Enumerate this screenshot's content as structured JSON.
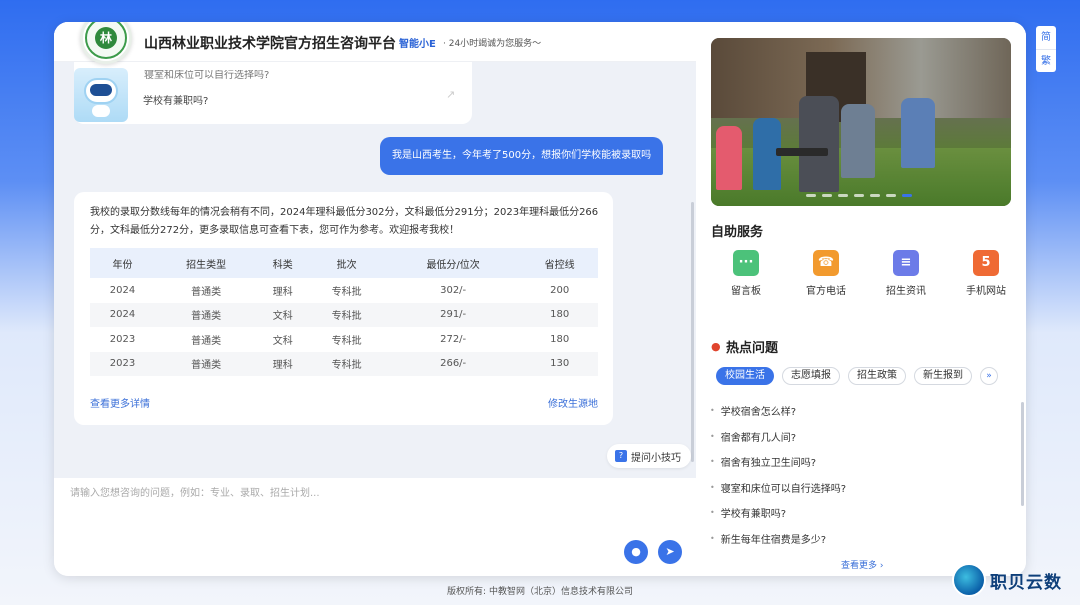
{
  "header": {
    "title": "山西林业职业技术学院官方招生咨询平台",
    "brand": "智能小E",
    "slogan": "· 24小时竭诚为您服务～"
  },
  "chat": {
    "prev_bot_cut_text": "寝室和床位可以自行选择吗?",
    "prev_bot_question": "学校有兼职吗?",
    "user_message": "我是山西考生，今年考了500分，想报你们学校能被录取吗",
    "answer_text": "我校的录取分数线每年的情况会稍有不同，2024年理科最低分302分，文科最低分291分；2023年理科最低分266分，文科最低分272分，更多录取信息可查看下表，您可作为参考。欢迎报考我校！",
    "table": {
      "headers": [
        "年份",
        "招生类型",
        "科类",
        "批次",
        "最低分/位次",
        "省控线"
      ],
      "rows": [
        [
          "2024",
          "普通类",
          "理科",
          "专科批",
          "302/-",
          "200"
        ],
        [
          "2024",
          "普通类",
          "文科",
          "专科批",
          "291/-",
          "180"
        ],
        [
          "2023",
          "普通类",
          "文科",
          "专科批",
          "272/-",
          "180"
        ],
        [
          "2023",
          "普通类",
          "理科",
          "专科批",
          "266/-",
          "130"
        ]
      ]
    },
    "more_link": "查看更多详情",
    "edit_link": "修改生源地",
    "tips_label": "提问小技巧",
    "input_placeholder": "请输入您想咨询的问题，例如：专业、录取、招生计划..."
  },
  "right": {
    "self_service_title": "自助服务",
    "services": [
      {
        "label": "留言板",
        "icon": "message-board-icon",
        "color": "#4cc27a",
        "glyph": "···"
      },
      {
        "label": "官方电话",
        "icon": "phone-icon",
        "color": "#f29a2e",
        "glyph": "☎"
      },
      {
        "label": "招生资讯",
        "icon": "news-icon",
        "color": "#6c7be8",
        "glyph": "≡"
      },
      {
        "label": "手机网站",
        "icon": "html5-icon",
        "color": "#ef6a34",
        "glyph": "5"
      }
    ],
    "hot_title": "热点问题",
    "tags": [
      "校园生活",
      "志愿填报",
      "招生政策",
      "新生报到"
    ],
    "hot_items": [
      "学校宿舍怎么样?",
      "宿舍都有几人间?",
      "宿舍有独立卫生间吗?",
      "寝室和床位可以自行选择吗?",
      "学校有兼职吗?",
      "新生每年住宿费是多少?"
    ],
    "hot_more": "查看更多 ›"
  },
  "lang": {
    "simplified": "简",
    "traditional": "繁"
  },
  "footer": "版权所有: 中教智网（北京）信息技术有限公司",
  "watermark": "职贝云数"
}
